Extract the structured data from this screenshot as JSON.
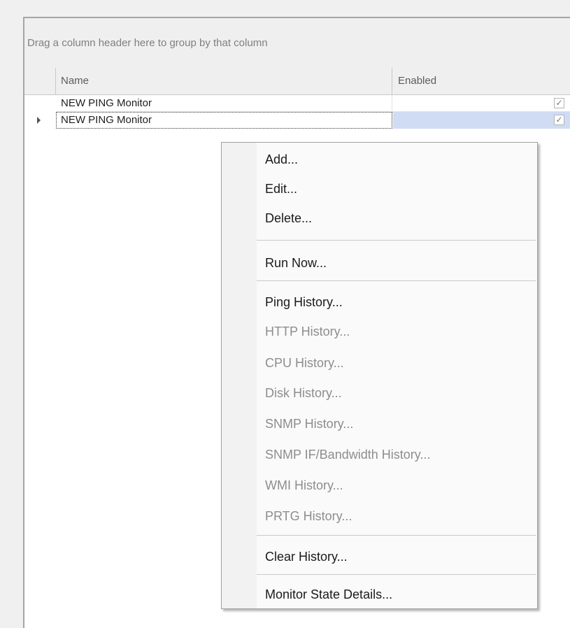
{
  "grid": {
    "group_panel_text": "Drag a column header here to group by that column",
    "columns": {
      "name": "Name",
      "enabled": "Enabled"
    },
    "rows": [
      {
        "name": "NEW PING Monitor",
        "enabled": "✓",
        "selected": false
      },
      {
        "name": "NEW PING Monitor",
        "enabled": "✓",
        "selected": true
      }
    ]
  },
  "context_menu": {
    "items": [
      {
        "label": "Add...",
        "enabled": true
      },
      {
        "label": "Edit...",
        "enabled": true
      },
      {
        "label": "Delete...",
        "enabled": true
      },
      {
        "label": "Run Now...",
        "enabled": true
      },
      {
        "label": "Ping History...",
        "enabled": true
      },
      {
        "label": "HTTP History...",
        "enabled": false
      },
      {
        "label": "CPU History...",
        "enabled": false
      },
      {
        "label": "Disk History...",
        "enabled": false
      },
      {
        "label": "SNMP History...",
        "enabled": false
      },
      {
        "label": "SNMP IF/Bandwidth History...",
        "enabled": false
      },
      {
        "label": "WMI History...",
        "enabled": false
      },
      {
        "label": "PRTG History...",
        "enabled": false
      },
      {
        "label": "Clear History...",
        "enabled": true
      },
      {
        "label": "Monitor State Details...",
        "enabled": true
      }
    ]
  },
  "colors": {
    "selection": "#cfdcf3",
    "disabled_text": "#8d8d8d",
    "background": "#f0f0f0"
  }
}
